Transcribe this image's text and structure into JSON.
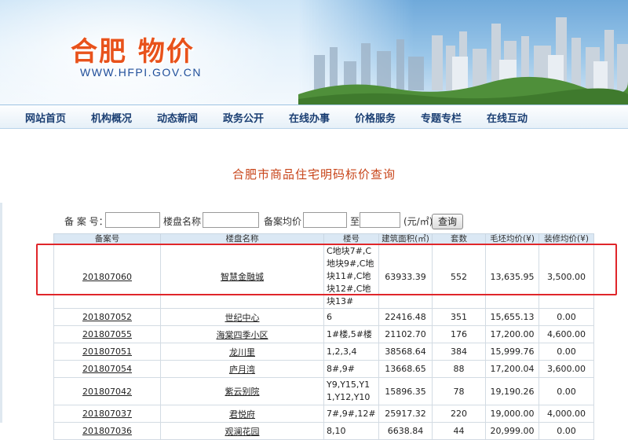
{
  "header": {
    "title": "合肥  物价",
    "url": "WWW.HFPI.GOV.CN"
  },
  "nav": [
    "网站首页",
    "机构概况",
    "动态新闻",
    "政务公开",
    "在线办事",
    "价格服务",
    "专题专栏",
    "在线互动"
  ],
  "page_title": "合肥市商品住宅明码标价查询",
  "search": {
    "label_no": "备 案 号：",
    "label_name": "楼盘名称：",
    "label_price": "备案均价：",
    "label_to": "至",
    "unit": "(元/㎡)",
    "button": "查询",
    "value_no": "",
    "value_name": "",
    "value_min": "",
    "value_max": ""
  },
  "table": {
    "headers": [
      "备案号",
      "楼盘名称",
      "楼号",
      "建筑面积(㎡)",
      "套数",
      "毛坯均价(¥)",
      "装修均价(¥)"
    ],
    "rows": [
      {
        "no": "201807060",
        "name": "智慧金融城",
        "bldg": "C地块7#,C地块9#,C地块11#,C地块12#,C地块13#",
        "area": "63933.39",
        "units": "552",
        "rough": "13,635.95",
        "deco": "3,500.00"
      },
      {
        "no": "201807052",
        "name": "世纪中心",
        "bldg": "6",
        "area": "22416.48",
        "units": "351",
        "rough": "15,655.13",
        "deco": "0.00"
      },
      {
        "no": "201807055",
        "name": "海棠四季小区",
        "bldg": "1#楼,5#楼",
        "area": "21102.70",
        "units": "176",
        "rough": "17,200.00",
        "deco": "4,600.00"
      },
      {
        "no": "201807051",
        "name": "龙川里",
        "bldg": "1,2,3,4",
        "area": "38568.64",
        "units": "384",
        "rough": "15,999.76",
        "deco": "0.00"
      },
      {
        "no": "201807054",
        "name": "庐月湾",
        "bldg": "8#,9#",
        "area": "13668.65",
        "units": "88",
        "rough": "17,200.04",
        "deco": "3,600.00"
      },
      {
        "no": "201807042",
        "name": "紫云别院",
        "bldg": "Y9,Y15,Y11,Y12,Y10",
        "area": "15896.35",
        "units": "78",
        "rough": "19,190.26",
        "deco": "0.00"
      },
      {
        "no": "201807037",
        "name": "君悦府",
        "bldg": "7#,9#,12#",
        "area": "25917.32",
        "units": "220",
        "rough": "19,000.00",
        "deco": "4,000.00"
      },
      {
        "no": "201807036",
        "name": "观澜花园",
        "bldg": "8,10",
        "area": "6638.84",
        "units": "44",
        "rough": "20,999.00",
        "deco": "0.00"
      }
    ]
  },
  "colors": {
    "title": "#e8521b",
    "url": "#1f4e9a",
    "nav": "#1b3f73",
    "page_title": "#c8451a",
    "highlight": "#e0262a"
  }
}
